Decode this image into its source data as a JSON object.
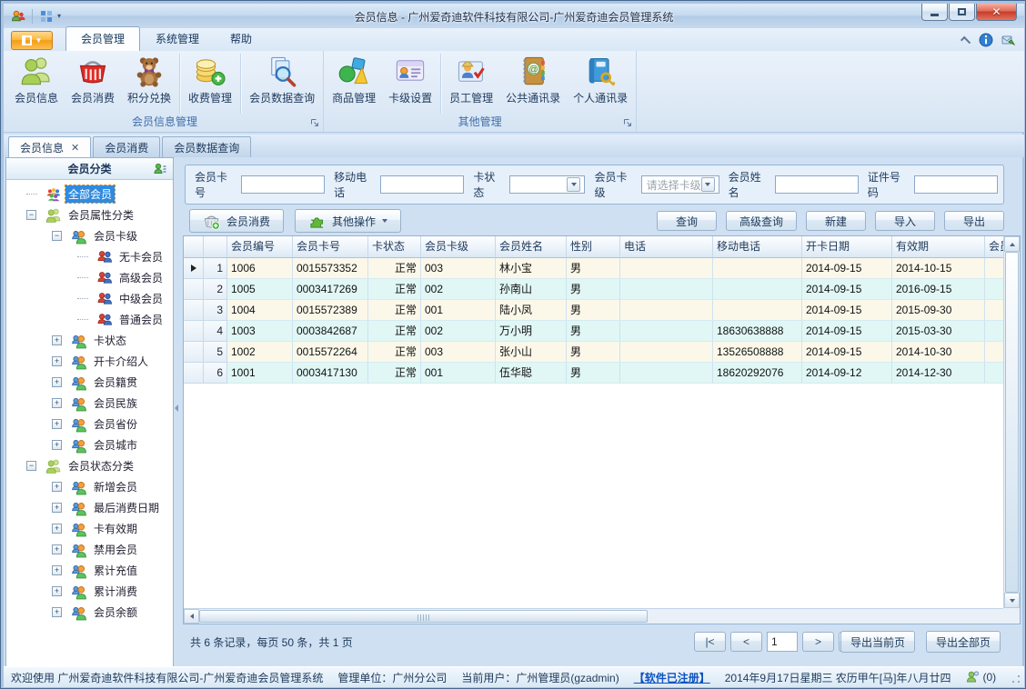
{
  "window": {
    "title": "会员信息 - 广州爱奇迪软件科技有限公司-广州爱奇迪会员管理系统",
    "titlebar_icons": [
      "member-app-icon",
      "layout-grid-icon"
    ],
    "controls": [
      "minimize-icon",
      "maximize-icon",
      "close-icon"
    ]
  },
  "ribbon": {
    "app_button_icon": "app-menu-icon",
    "tabs": [
      {
        "label": "会员管理",
        "active": true
      },
      {
        "label": "系统管理",
        "active": false
      },
      {
        "label": "帮助",
        "active": false
      }
    ],
    "right_icons": [
      "collapse-ribbon-icon",
      "info-icon",
      "feedback-icon"
    ],
    "groups": [
      {
        "label": "会员信息管理",
        "buttons": [
          {
            "label": "会员信息",
            "icon": "users-green",
            "sep_after": false
          },
          {
            "label": "会员消费",
            "icon": "basket-red",
            "sep_after": false
          },
          {
            "label": "积分兑换",
            "icon": "teddy-bear",
            "sep_after": true
          },
          {
            "label": "收费管理",
            "icon": "coins-add",
            "sep_after": true
          },
          {
            "label": "会员数据查询",
            "icon": "doc-search",
            "sep_after": false
          }
        ]
      },
      {
        "label": "其他管理",
        "buttons": [
          {
            "label": "商品管理",
            "icon": "shapes",
            "sep_after": false
          },
          {
            "label": "卡级设置",
            "icon": "member-card",
            "sep_after": true
          },
          {
            "label": "员工管理",
            "icon": "staff-puzzle",
            "sep_after": false
          },
          {
            "label": "公共通讯录",
            "icon": "address-book",
            "sep_after": false
          },
          {
            "label": "个人通讯录",
            "icon": "book-key",
            "sep_after": false
          }
        ]
      }
    ]
  },
  "doc_tabs": [
    {
      "label": "会员信息",
      "active": true,
      "closable": true
    },
    {
      "label": "会员消费",
      "active": false,
      "closable": false
    },
    {
      "label": "会员数据查询",
      "active": false,
      "closable": false
    }
  ],
  "sidebar": {
    "title": "会员分类",
    "header_icon": "user-list-icon",
    "tree": [
      {
        "label": "全部会员",
        "level": 0,
        "icon": "users-colorful",
        "expander": "none",
        "selected": true
      },
      {
        "label": "会员属性分类",
        "level": 0,
        "icon": "users-green",
        "expander": "minus",
        "selected": false
      },
      {
        "label": "会员卡级",
        "level": 1,
        "icon": "users-duo",
        "expander": "minus",
        "selected": false
      },
      {
        "label": "无卡会员",
        "level": 2,
        "icon": "users-pair",
        "expander": "none",
        "selected": false
      },
      {
        "label": "高级会员",
        "level": 2,
        "icon": "users-pair",
        "expander": "none",
        "selected": false
      },
      {
        "label": "中级会员",
        "level": 2,
        "icon": "users-pair",
        "expander": "none",
        "selected": false
      },
      {
        "label": "普通会员",
        "level": 2,
        "icon": "users-pair",
        "expander": "none",
        "selected": false
      },
      {
        "label": "卡状态",
        "level": 1,
        "icon": "users-duo",
        "expander": "plus",
        "selected": false
      },
      {
        "label": "开卡介绍人",
        "level": 1,
        "icon": "users-duo",
        "expander": "plus",
        "selected": false
      },
      {
        "label": "会员籍贯",
        "level": 1,
        "icon": "users-duo",
        "expander": "plus",
        "selected": false
      },
      {
        "label": "会员民族",
        "level": 1,
        "icon": "users-duo",
        "expander": "plus",
        "selected": false
      },
      {
        "label": "会员省份",
        "level": 1,
        "icon": "users-duo",
        "expander": "plus",
        "selected": false
      },
      {
        "label": "会员城市",
        "level": 1,
        "icon": "users-duo",
        "expander": "plus",
        "selected": false
      },
      {
        "label": "会员状态分类",
        "level": 0,
        "icon": "users-green",
        "expander": "minus",
        "selected": false
      },
      {
        "label": "新增会员",
        "level": 1,
        "icon": "users-duo",
        "expander": "plus",
        "selected": false
      },
      {
        "label": "最后消费日期",
        "level": 1,
        "icon": "users-duo",
        "expander": "plus",
        "selected": false
      },
      {
        "label": "卡有效期",
        "level": 1,
        "icon": "users-duo",
        "expander": "plus",
        "selected": false
      },
      {
        "label": "禁用会员",
        "level": 1,
        "icon": "users-duo",
        "expander": "plus",
        "selected": false
      },
      {
        "label": "累计充值",
        "level": 1,
        "icon": "users-duo",
        "expander": "plus",
        "selected": false
      },
      {
        "label": "累计消费",
        "level": 1,
        "icon": "users-duo",
        "expander": "plus",
        "selected": false
      },
      {
        "label": "会员余额",
        "level": 1,
        "icon": "users-duo",
        "expander": "plus",
        "selected": false
      }
    ]
  },
  "filters": [
    {
      "label": "会员卡号",
      "type": "text",
      "value": "",
      "placeholder": ""
    },
    {
      "label": "移动电话",
      "type": "text",
      "value": "",
      "placeholder": ""
    },
    {
      "label": "卡状态",
      "type": "select",
      "value": "",
      "placeholder": ""
    },
    {
      "label": "会员卡级",
      "type": "select",
      "value": "",
      "placeholder": "请选择卡级"
    },
    {
      "label": "会员姓名",
      "type": "text",
      "value": "",
      "placeholder": ""
    },
    {
      "label": "证件号码",
      "type": "text",
      "value": "",
      "placeholder": ""
    }
  ],
  "toolbar": {
    "member_consume_label": "会员消费",
    "member_consume_icon": "basket-add-icon",
    "other_ops_label": "其他操作",
    "other_ops_icon": "puzzle-green-icon",
    "actions": [
      "查询",
      "高级查询",
      "新建",
      "导入",
      "导出"
    ]
  },
  "table": {
    "columns": [
      "会员编号",
      "会员卡号",
      "卡状态",
      "会员卡级",
      "会员姓名",
      "性别",
      "电话",
      "移动电话",
      "开卡日期",
      "有效期",
      "会员"
    ],
    "rows": [
      {
        "num": "1",
        "current": true,
        "cells": [
          "1006",
          "0015573352",
          "正常",
          "003",
          "林小宝",
          "男",
          "",
          "",
          "2014-09-15",
          "2014-10-15",
          ""
        ]
      },
      {
        "num": "2",
        "current": false,
        "cells": [
          "1005",
          "0003417269",
          "正常",
          "002",
          "孙南山",
          "男",
          "",
          "",
          "2014-09-15",
          "2016-09-15",
          ""
        ]
      },
      {
        "num": "3",
        "current": false,
        "cells": [
          "1004",
          "0015572389",
          "正常",
          "001",
          "陆小凤",
          "男",
          "",
          "",
          "2014-09-15",
          "2015-09-30",
          ""
        ]
      },
      {
        "num": "4",
        "current": false,
        "cells": [
          "1003",
          "0003842687",
          "正常",
          "002",
          "万小明",
          "男",
          "",
          "18630638888",
          "2014-09-15",
          "2015-03-30",
          ""
        ]
      },
      {
        "num": "5",
        "current": false,
        "cells": [
          "1002",
          "0015572264",
          "正常",
          "003",
          "张小山",
          "男",
          "",
          "13526508888",
          "2014-09-15",
          "2014-10-30",
          ""
        ]
      },
      {
        "num": "6",
        "current": false,
        "cells": [
          "1001",
          "0003417130",
          "正常",
          "001",
          "伍华聪",
          "男",
          "",
          "18620292076",
          "2014-09-12",
          "2014-12-30",
          ""
        ]
      }
    ],
    "row_colors": {
      "odd": "#fbf8ea",
      "even": "#e0f7f5"
    }
  },
  "pager": {
    "summary": "共 6 条记录，每页 50 条，共 1 页",
    "first": "|<",
    "prev": "<",
    "page_value": "1",
    "next": ">",
    "last": ">|",
    "export_current": "导出当前页",
    "export_all": "导出全部页"
  },
  "statusbar": {
    "welcome": "欢迎使用 广州爱奇迪软件科技有限公司-广州爱奇迪会员管理系统",
    "org": "管理单位：广州分公司",
    "user": "当前用户：广州管理员(gzadmin)",
    "registered": "【软件已注册】",
    "datetime": "2014年9月17日星期三 农历甲午[马]年八月廿四",
    "online_icon": "user-status-icon",
    "online_count": "(0)"
  },
  "colors": {
    "accent": "#2f8be0",
    "close_red": "#c93c28",
    "app_orange": "#f59d14"
  }
}
